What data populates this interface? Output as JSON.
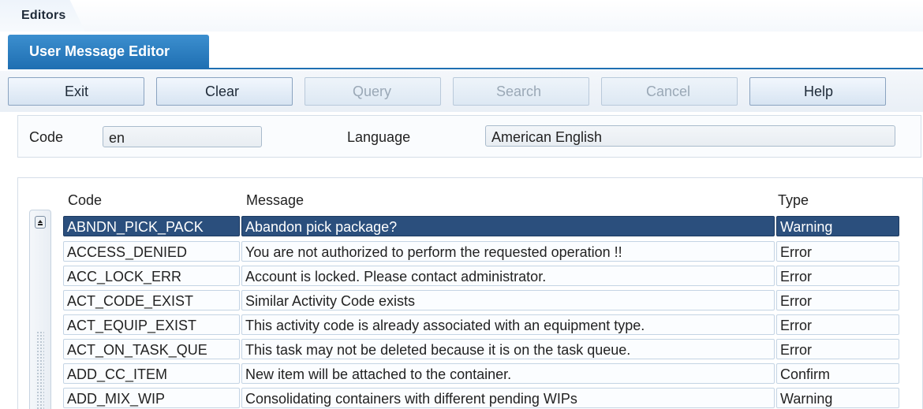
{
  "header": {
    "editors_tab": "Editors",
    "title": "User Message Editor"
  },
  "toolbar": [
    {
      "label": "Exit",
      "enabled": true
    },
    {
      "label": "Clear",
      "enabled": true
    },
    {
      "label": "Query",
      "enabled": false
    },
    {
      "label": "Search",
      "enabled": false
    },
    {
      "label": "Cancel",
      "enabled": false
    },
    {
      "label": "Help",
      "enabled": true
    }
  ],
  "form": {
    "code_label": "Code",
    "code_value": "en",
    "language_label": "Language",
    "language_value": "American English"
  },
  "table": {
    "headers": {
      "code": "Code",
      "message": "Message",
      "type": "Type"
    },
    "selected_index": 0,
    "rows": [
      {
        "code": "ABNDN_PICK_PACK",
        "message": "Abandon pick package?",
        "type": "Warning"
      },
      {
        "code": "ACCESS_DENIED",
        "message": "You are not authorized to perform the requested operation !!",
        "type": "Error"
      },
      {
        "code": "ACC_LOCK_ERR",
        "message": "Account is locked. Please contact administrator.",
        "type": "Error"
      },
      {
        "code": "ACT_CODE_EXIST",
        "message": "Similar Activity Code exists",
        "type": "Error"
      },
      {
        "code": "ACT_EQUIP_EXIST",
        "message": "This activity code is already associated with an equipment type.",
        "type": "Error"
      },
      {
        "code": "ACT_ON_TASK_QUE",
        "message": "This task may not be deleted because it is on the task queue.",
        "type": "Error"
      },
      {
        "code": "ADD_CC_ITEM",
        "message": "New item will be attached to the container.",
        "type": "Confirm"
      },
      {
        "code": "ADD_MIX_WIP",
        "message": "Consolidating containers with different pending WIPs",
        "type": "Warning"
      }
    ]
  },
  "colors": {
    "accent": "#1f6fb2",
    "selected_row": "#2b4f7d"
  }
}
